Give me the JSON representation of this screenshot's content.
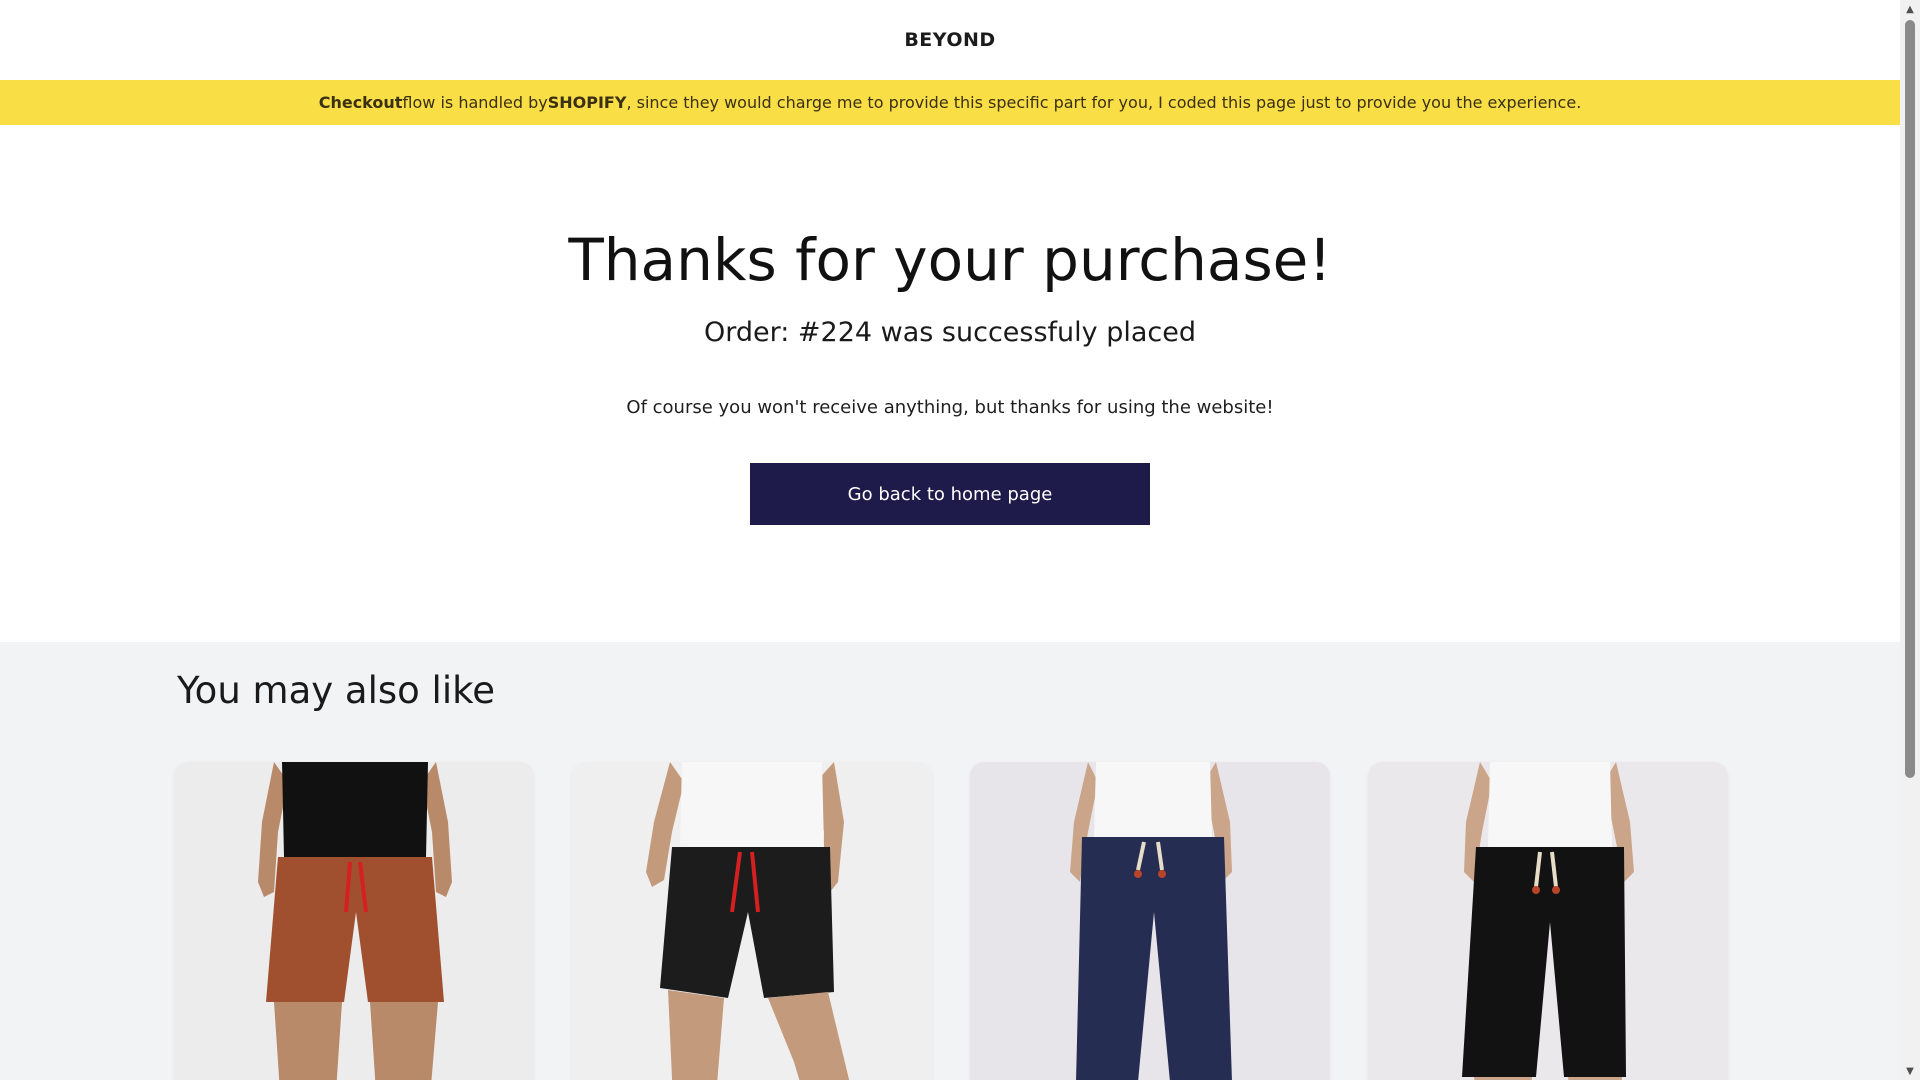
{
  "header": {
    "brand": "BEYOND"
  },
  "notice": {
    "part1_bold": "Checkout",
    "part2": " flow is handled by ",
    "part3_bold": "SHOPIFY",
    "part4": ", since they would charge me to provide this specific part for you, I coded this page just to provide you the experience."
  },
  "thanks": {
    "title": "Thanks for your purchase!",
    "order_line": "Order: #224 was successfuly placed",
    "message": "Of course you won't receive anything, but thanks for using the website!",
    "home_button": "Go back to home page"
  },
  "recommendations": {
    "title": "You may also like",
    "products": [
      {
        "icon": "brown-shorts-image",
        "shorts_color": "#a0502f",
        "top_color": "#111111",
        "drawstring": "#d42020",
        "bg": "#ececec"
      },
      {
        "icon": "black-shorts-image",
        "shorts_color": "#1c1c1c",
        "top_color": "#f7f7f7",
        "drawstring": "#d42020",
        "bg": "#efefef"
      },
      {
        "icon": "navy-pants-image",
        "shorts_color": "#252d52",
        "top_color": "#f7f7f7",
        "drawstring": "#e6dcc8",
        "bg": "#e7e4ea"
      },
      {
        "icon": "black-pants-image",
        "shorts_color": "#121212",
        "top_color": "#f7f7f7",
        "drawstring": "#e6dcc8",
        "bg": "#ebe8ec"
      }
    ]
  },
  "colors": {
    "notice_bg": "#f9de45",
    "button_bg": "#1e1b4b",
    "recs_bg": "#f2f3f5"
  }
}
